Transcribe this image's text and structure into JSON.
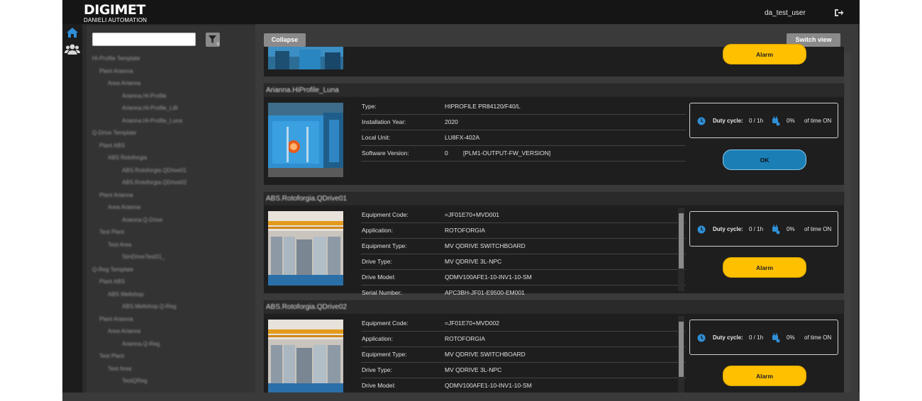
{
  "header": {
    "logo_main": "DIGIMET",
    "logo_sub": "DANIELI AUTOMATION",
    "username": "da_test_user",
    "logout_icon": "logout-icon"
  },
  "nav": {
    "items": [
      {
        "icon": "home-icon",
        "color": "#2f8fd6"
      },
      {
        "icon": "users-icon",
        "color": "#d8d8d8"
      }
    ]
  },
  "tree": {
    "search_value": "",
    "filter_count": "0",
    "nodes": [
      {
        "label": "Hi-Profile Template",
        "level": 0
      },
      {
        "label": "Plant Arianna",
        "level": 1
      },
      {
        "label": "Area Arianna",
        "level": 2
      },
      {
        "label": "Arianna.Hi-Profile",
        "level": 3
      },
      {
        "label": "Arianna.Hi-Profile_Lilli",
        "level": 3
      },
      {
        "label": "Arianna.Hi-Profile_Luna",
        "level": 3
      },
      {
        "label": "Q-Drive Template",
        "level": 0
      },
      {
        "label": "Plant ABS",
        "level": 1
      },
      {
        "label": "ABS Rotoforgia",
        "level": 2
      },
      {
        "label": "ABS.Rotoforgia.QDrive01",
        "level": 3
      },
      {
        "label": "ABS.Rotoforgia.QDrive02",
        "level": 3
      },
      {
        "label": "Plant Arianna",
        "level": 1
      },
      {
        "label": "Area Arianna",
        "level": 2
      },
      {
        "label": "Arianna.Q-Drive",
        "level": 3
      },
      {
        "label": "Test Plant",
        "level": 1
      },
      {
        "label": "Test Area",
        "level": 2
      },
      {
        "label": "SimDriveTest01_",
        "level": 3
      },
      {
        "label": "Q-Reg Template",
        "level": 0
      },
      {
        "label": "Plant ABS",
        "level": 1
      },
      {
        "label": "ABS Meltshop",
        "level": 2
      },
      {
        "label": "ABS.Meltshop.Q-Reg",
        "level": 3
      },
      {
        "label": "Plant Arianna",
        "level": 1
      },
      {
        "label": "Area Arianna",
        "level": 2
      },
      {
        "label": "Arianna.Q-Reg",
        "level": 3
      },
      {
        "label": "Test Plant",
        "level": 1
      },
      {
        "label": "Test Area",
        "level": 2
      },
      {
        "label": "TestQReg",
        "level": 3
      }
    ]
  },
  "toolbar": {
    "collapse_label": "Collapse",
    "switch_label": "Switch view"
  },
  "cards": [
    {
      "title": "",
      "status": "Alarm",
      "status_type": "alarm",
      "image": "switchboard-photo"
    },
    {
      "title": "Arianna.HiProfile_Luna",
      "image": "cabinet-photo",
      "fields": [
        {
          "key": "Type:",
          "value": "HIPROFILE PR84120/F40/L"
        },
        {
          "key": "Installation Year:",
          "value": "2020"
        },
        {
          "key": "Local Unit:",
          "value": "LU8FX-402A"
        },
        {
          "key": "Software Version:",
          "value": "0",
          "value2": "[PLM1-OUTPUT-FW_VERSION]"
        }
      ],
      "duty_label": "Duty cycle:",
      "duty_value": "0 / 1h",
      "duty_pct": "0%",
      "duty_suffix": "of time ON",
      "status": "OK",
      "status_type": "ok"
    },
    {
      "title": "ABS.Rotoforgia.QDrive01",
      "image": "switchboard-photo",
      "fields": [
        {
          "key": "Equipment Code:",
          "value": "=JF01E70+MVD001"
        },
        {
          "key": "Application:",
          "value": "ROTOFORGIA"
        },
        {
          "key": "Equipment Type:",
          "value": "MV QDRIVE SWITCHBOARD"
        },
        {
          "key": "Drive Type:",
          "value": "MV QDRIVE 3L-NPC"
        },
        {
          "key": "Drive Model:",
          "value": "QDMV100AFE1-10-INV1-10-SM"
        },
        {
          "key": "Serial Number:",
          "value": "APC3BH-JF01-E9500-EM001"
        }
      ],
      "duty_label": "Duty cycle:",
      "duty_value": "0 / 1h",
      "duty_pct": "0%",
      "duty_suffix": "of time ON",
      "status": "Alarm",
      "status_type": "alarm"
    },
    {
      "title": "ABS.Rotoforgia.QDrive02",
      "image": "switchboard-photo",
      "fields": [
        {
          "key": "Equipment Code:",
          "value": "=JF01E70+MVD002"
        },
        {
          "key": "Application:",
          "value": "ROTOFORGIA"
        },
        {
          "key": "Equipment Type:",
          "value": "MV QDRIVE SWITCHBOARD"
        },
        {
          "key": "Drive Type:",
          "value": "MV QDRIVE 3L-NPC"
        },
        {
          "key": "Drive Model:",
          "value": "QDMV100AFE1-10-INV1-10-SM"
        }
      ],
      "duty_label": "Duty cycle:",
      "duty_value": "0 / 1h",
      "duty_pct": "0%",
      "duty_suffix": "of time ON",
      "status": "Alarm",
      "status_type": "alarm"
    }
  ],
  "colors": {
    "accent": "#2f8fd6",
    "alarm": "#ffc000",
    "ok": "#1b7fb6"
  }
}
